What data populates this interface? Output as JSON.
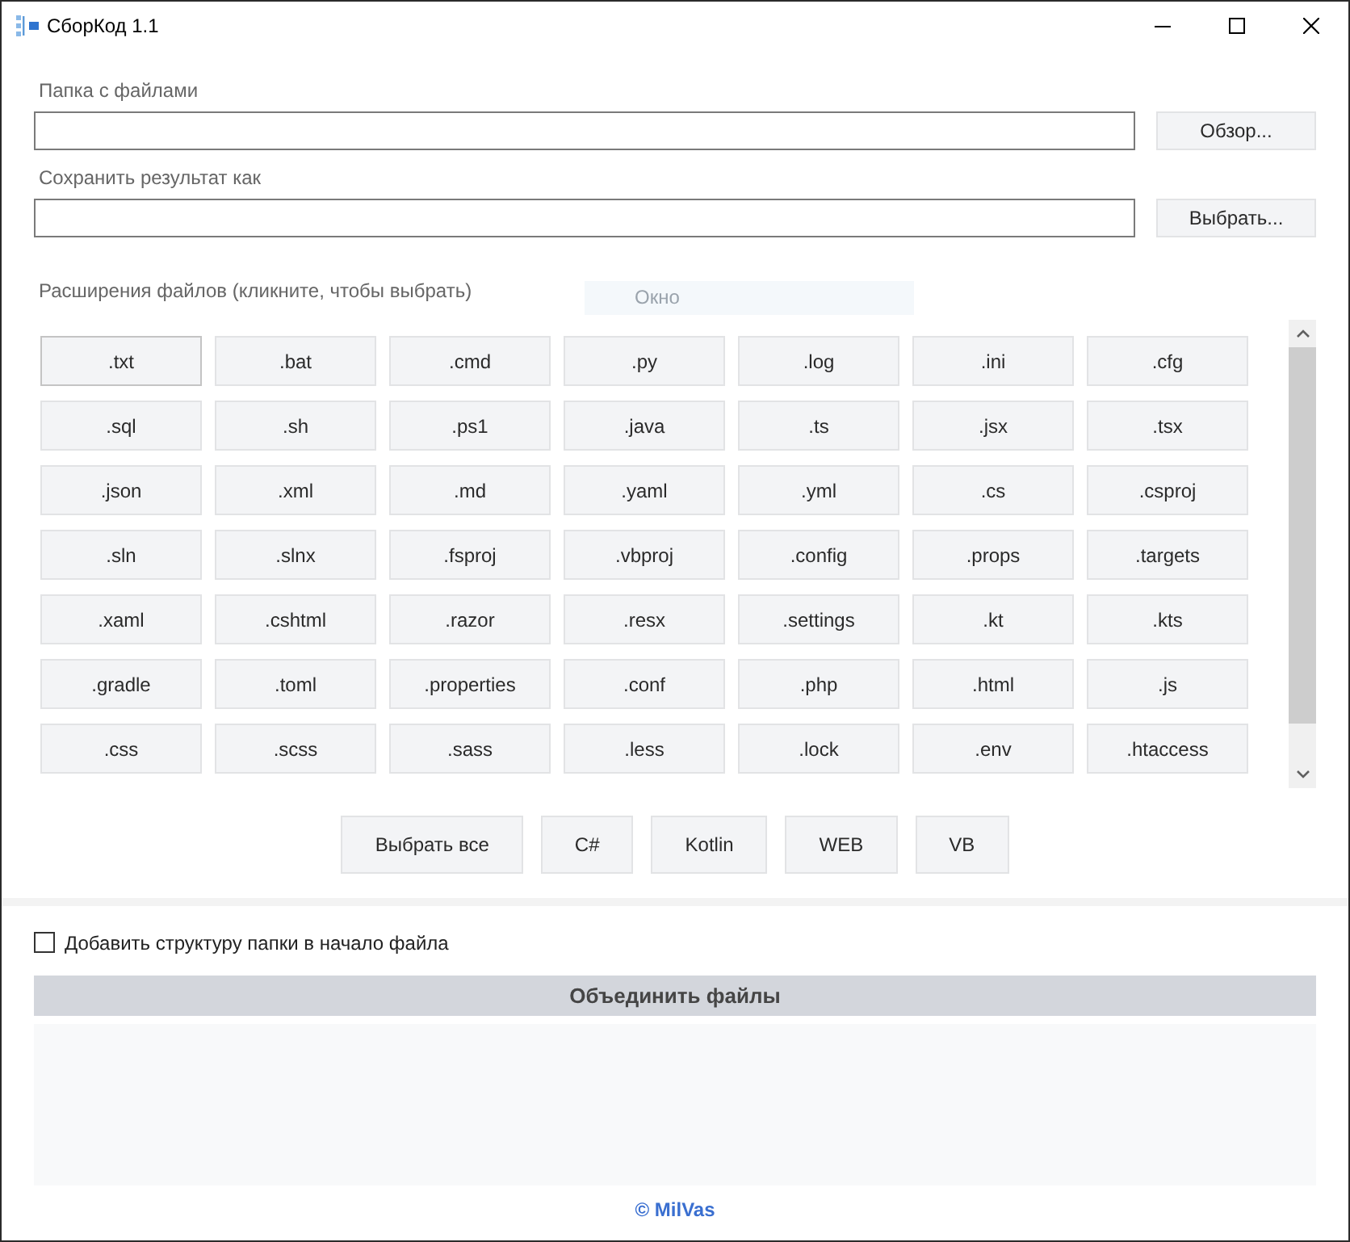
{
  "window": {
    "title": "СборКод 1.1"
  },
  "source_folder": {
    "label": "Папка с файлами",
    "button": "Обзор..."
  },
  "output_file": {
    "label": "Сохранить результат как",
    "button": "Выбрать..."
  },
  "extensions": {
    "label": "Расширения файлов (кликните, чтобы выбрать)",
    "faded_label": "Окно",
    "items": [
      {
        "label": ".txt",
        "focused": true
      },
      {
        "label": ".bat",
        "focused": false
      },
      {
        "label": ".cmd",
        "focused": false
      },
      {
        "label": ".py",
        "focused": false
      },
      {
        "label": ".log",
        "focused": false
      },
      {
        "label": ".ini",
        "focused": false
      },
      {
        "label": ".cfg",
        "focused": false
      },
      {
        "label": ".sql",
        "focused": false
      },
      {
        "label": ".sh",
        "focused": false
      },
      {
        "label": ".ps1",
        "focused": false
      },
      {
        "label": ".java",
        "focused": false
      },
      {
        "label": ".ts",
        "focused": false
      },
      {
        "label": ".jsx",
        "focused": false
      },
      {
        "label": ".tsx",
        "focused": false
      },
      {
        "label": ".json",
        "focused": false
      },
      {
        "label": ".xml",
        "focused": false
      },
      {
        "label": ".md",
        "focused": false
      },
      {
        "label": ".yaml",
        "focused": false
      },
      {
        "label": ".yml",
        "focused": false
      },
      {
        "label": ".cs",
        "focused": false
      },
      {
        "label": ".csproj",
        "focused": false
      },
      {
        "label": ".sln",
        "focused": false
      },
      {
        "label": ".slnx",
        "focused": false
      },
      {
        "label": ".fsproj",
        "focused": false
      },
      {
        "label": ".vbproj",
        "focused": false
      },
      {
        "label": ".config",
        "focused": false
      },
      {
        "label": ".props",
        "focused": false
      },
      {
        "label": ".targets",
        "focused": false
      },
      {
        "label": ".xaml",
        "focused": false
      },
      {
        "label": ".cshtml",
        "focused": false
      },
      {
        "label": ".razor",
        "focused": false
      },
      {
        "label": ".resx",
        "focused": false
      },
      {
        "label": ".settings",
        "focused": false
      },
      {
        "label": ".kt",
        "focused": false
      },
      {
        "label": ".kts",
        "focused": false
      },
      {
        "label": ".gradle",
        "focused": false
      },
      {
        "label": ".toml",
        "focused": false
      },
      {
        "label": ".properties",
        "focused": false
      },
      {
        "label": ".conf",
        "focused": false
      },
      {
        "label": ".php",
        "focused": false
      },
      {
        "label": ".html",
        "focused": false
      },
      {
        "label": ".js",
        "focused": false
      },
      {
        "label": ".css",
        "focused": false
      },
      {
        "label": ".scss",
        "focused": false
      },
      {
        "label": ".sass",
        "focused": false
      },
      {
        "label": ".less",
        "focused": false
      },
      {
        "label": ".lock",
        "focused": false
      },
      {
        "label": ".env",
        "focused": false
      },
      {
        "label": ".htaccess",
        "focused": false
      }
    ]
  },
  "presets": [
    "Выбрать все",
    "C#",
    "Kotlin",
    "WEB",
    "VB"
  ],
  "prepend_structure": {
    "label": "Добавить структуру папки в начало файла",
    "checked": false
  },
  "merge_button": "Объединить файлы",
  "footer": "© MilVas"
}
